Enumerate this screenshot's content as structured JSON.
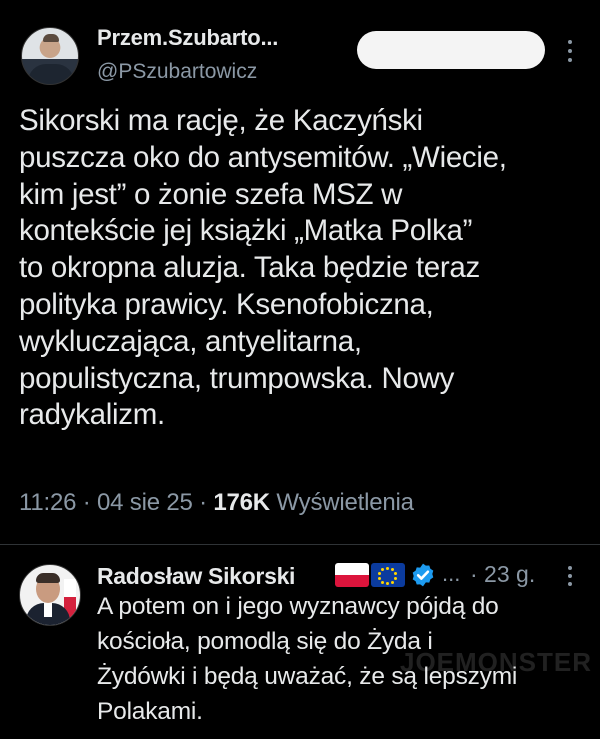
{
  "main_tweet": {
    "author_name": "Przem.Szubarto...",
    "author_handle": "@PSzubartowicz",
    "text_lines": [
      "Sikorski ma rację, że Kaczyński",
      "puszcza oko do antysemitów. „Wiecie,",
      "kim jest” o żonie szefa MSZ w",
      "kontekście jej książki „Matka Polka”",
      "to okropna aluzja. Taka będzie teraz",
      "polityka prawicy. Ksenofobiczna,",
      "wykluczająca, antyelitarna,",
      "populistyczna, trumpowska. Nowy",
      "radykalizm."
    ],
    "time": "11:26",
    "date": "04 sie 25",
    "separator": "·",
    "views_count": "176K",
    "views_label": "Wyświetlenia"
  },
  "reply": {
    "author_name": "Radosław Sikorski",
    "ellipsis": "...",
    "time_ago": "· 23 g.",
    "text_lines": [
      "A potem on i jego wyznawcy pójdą do",
      "kościoła, pomodlą się do Żyda i",
      "Żydówki i będą uważać, że są lepszymi",
      "Polakami."
    ],
    "watermark": "JOEMONSTER"
  },
  "icons": {
    "main_more": "more-vertical-icon",
    "reply_more": "more-vertical-icon",
    "verified": "verified-badge-icon",
    "flag_pl": "poland-flag-icon",
    "flag_eu": "eu-flag-icon"
  },
  "colors": {
    "background": "#000000",
    "text": "#e7e9ea",
    "secondary": "#8b98a5",
    "verified": "#1d9bf0",
    "divider": "#2f3336"
  }
}
